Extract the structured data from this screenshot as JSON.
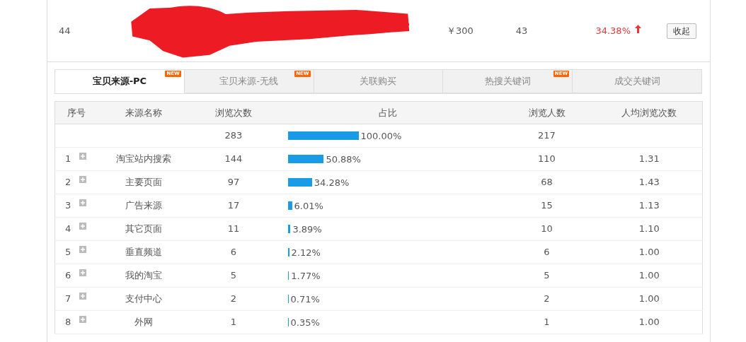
{
  "product_row": {
    "index": "44",
    "price": "￥300",
    "count": "43",
    "rate": "34.38%",
    "collapse_button": "收起"
  },
  "tabs": [
    {
      "label": "宝贝来源-PC",
      "selected": true,
      "new_badge": "NEW"
    },
    {
      "label": "宝贝来源-无线",
      "selected": false,
      "new_badge": "NEW"
    },
    {
      "label": "关联购买",
      "selected": false
    },
    {
      "label": "热搜关键词",
      "selected": false,
      "new_badge": "NEW"
    },
    {
      "label": "成交关键词",
      "selected": false
    }
  ],
  "table": {
    "columns": [
      "序号",
      "来源名称",
      "浏览次数",
      "占比",
      "浏览人数",
      "人均浏览次数"
    ],
    "rows": [
      {
        "views": "283",
        "share": "100.00%",
        "visitors": "217"
      },
      {
        "no": "1",
        "expandable": true,
        "source": "淘宝站内搜索",
        "views": "144",
        "share": "50.88%",
        "visitors": "110",
        "avg": "1.31"
      },
      {
        "no": "2",
        "expandable": true,
        "source": "主要页面",
        "views": "97",
        "share": "34.28%",
        "visitors": "68",
        "avg": "1.43"
      },
      {
        "no": "3",
        "expandable": true,
        "source": "广告来源",
        "views": "17",
        "share": "6.01%",
        "visitors": "15",
        "avg": "1.13"
      },
      {
        "no": "4",
        "expandable": true,
        "source": "其它页面",
        "views": "11",
        "share": "3.89%",
        "visitors": "10",
        "avg": "1.10"
      },
      {
        "no": "5",
        "expandable": true,
        "source": "垂直频道",
        "views": "6",
        "share": "2.12%",
        "visitors": "6",
        "avg": "1.00"
      },
      {
        "no": "6",
        "expandable": true,
        "source": "我的淘宝",
        "views": "5",
        "share": "1.77%",
        "visitors": "5",
        "avg": "1.00"
      },
      {
        "no": "7",
        "expandable": true,
        "source": "支付中心",
        "views": "2",
        "share": "0.71%",
        "visitors": "2",
        "avg": "1.00"
      },
      {
        "no": "8",
        "expandable": true,
        "source": "外网",
        "views": "1",
        "share": "0.35%",
        "visitors": "1",
        "avg": "1.00"
      }
    ]
  }
}
